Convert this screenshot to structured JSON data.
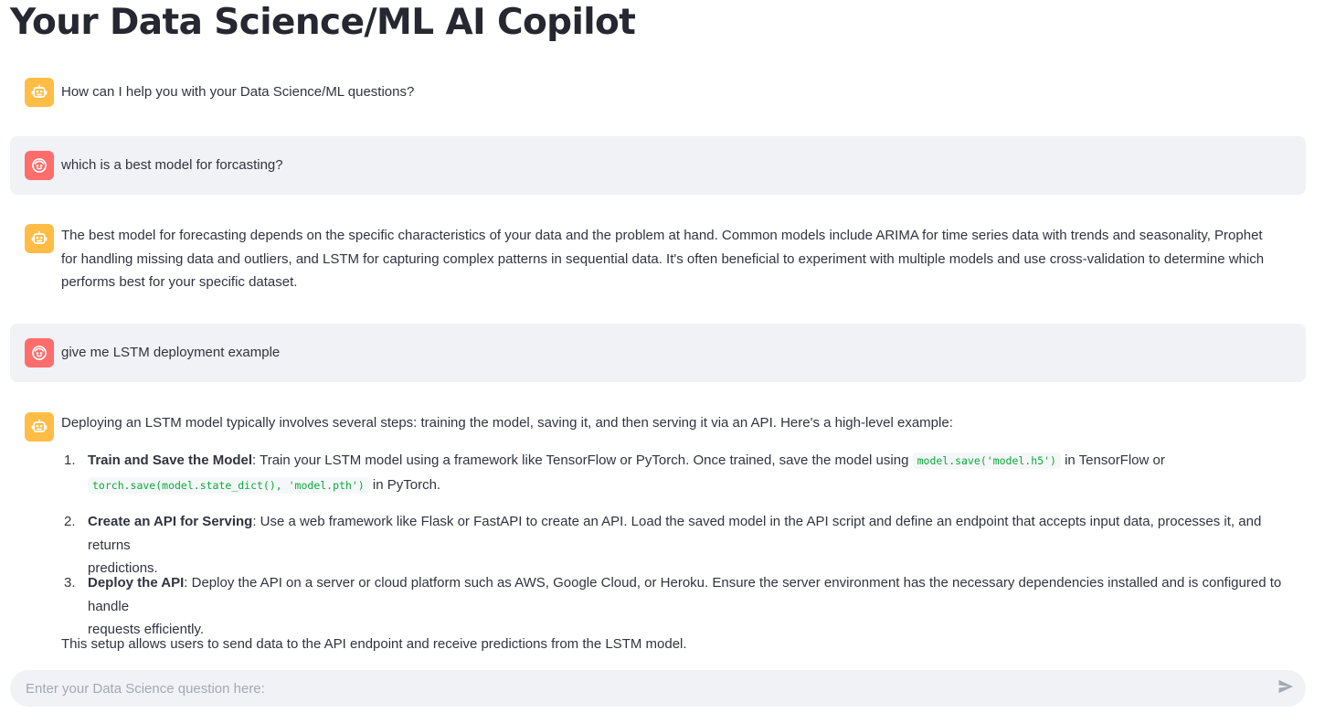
{
  "app": {
    "title": "Your Data Science/ML AI Copilot"
  },
  "colors": {
    "assistant_avatar": "#ffbd45",
    "user_avatar": "#ff6c6c",
    "user_message_bg": "#f0f2f6",
    "code_text": "#09ab3b"
  },
  "messages": [
    {
      "role": "assistant",
      "icon": "robot-icon",
      "text": "How can I help you with your Data Science/ML questions?"
    },
    {
      "role": "user",
      "icon": "face-icon",
      "text": "which is a best model for forcasting?"
    },
    {
      "role": "assistant",
      "icon": "robot-icon",
      "text": "The best model for forecasting depends on the specific characteristics of your data and the problem at hand. Common models include ARIMA for time series data with trends and seasonality, Prophet for handling missing data and outliers, and LSTM for capturing complex patterns in sequential data. It's often beneficial to experiment with multiple models and use cross-validation to determine which performs best for your specific dataset."
    },
    {
      "role": "user",
      "icon": "face-icon",
      "text": "give me LSTM deployment example"
    },
    {
      "role": "assistant",
      "icon": "robot-icon",
      "intro": "Deploying an LSTM model typically involves several steps: training the model, saving it, and then serving it via an API. Here's a high-level example:",
      "steps": [
        {
          "number": "1.",
          "title": "Train and Save the Model",
          "text_a": ": Train your LSTM model using a framework like TensorFlow or PyTorch. Once trained, save the model using ",
          "code_a": "model.save('model.h5')",
          "text_b": " in TensorFlow or",
          "code_b": "torch.save(model.state_dict(), 'model.pth')",
          "text_c": " in PyTorch."
        },
        {
          "number": "2.",
          "title": "Create an API for Serving",
          "text_a": ": Use a web framework like Flask or FastAPI to create an API. Load the saved model in the API script and define an endpoint that accepts input data, processes it, and returns",
          "text_b": "predictions."
        },
        {
          "number": "3.",
          "title": "Deploy the API",
          "text_a": ": Deploy the API on a server or cloud platform such as AWS, Google Cloud, or Heroku. Ensure the server environment has the necessary dependencies installed and is configured to handle",
          "text_b": "requests efficiently."
        }
      ],
      "outro": "This setup allows users to send data to the API endpoint and receive predictions from the LSTM model."
    }
  ],
  "chat_input": {
    "placeholder": "Enter your Data Science question here:",
    "value": "",
    "send_icon": "send-icon"
  }
}
